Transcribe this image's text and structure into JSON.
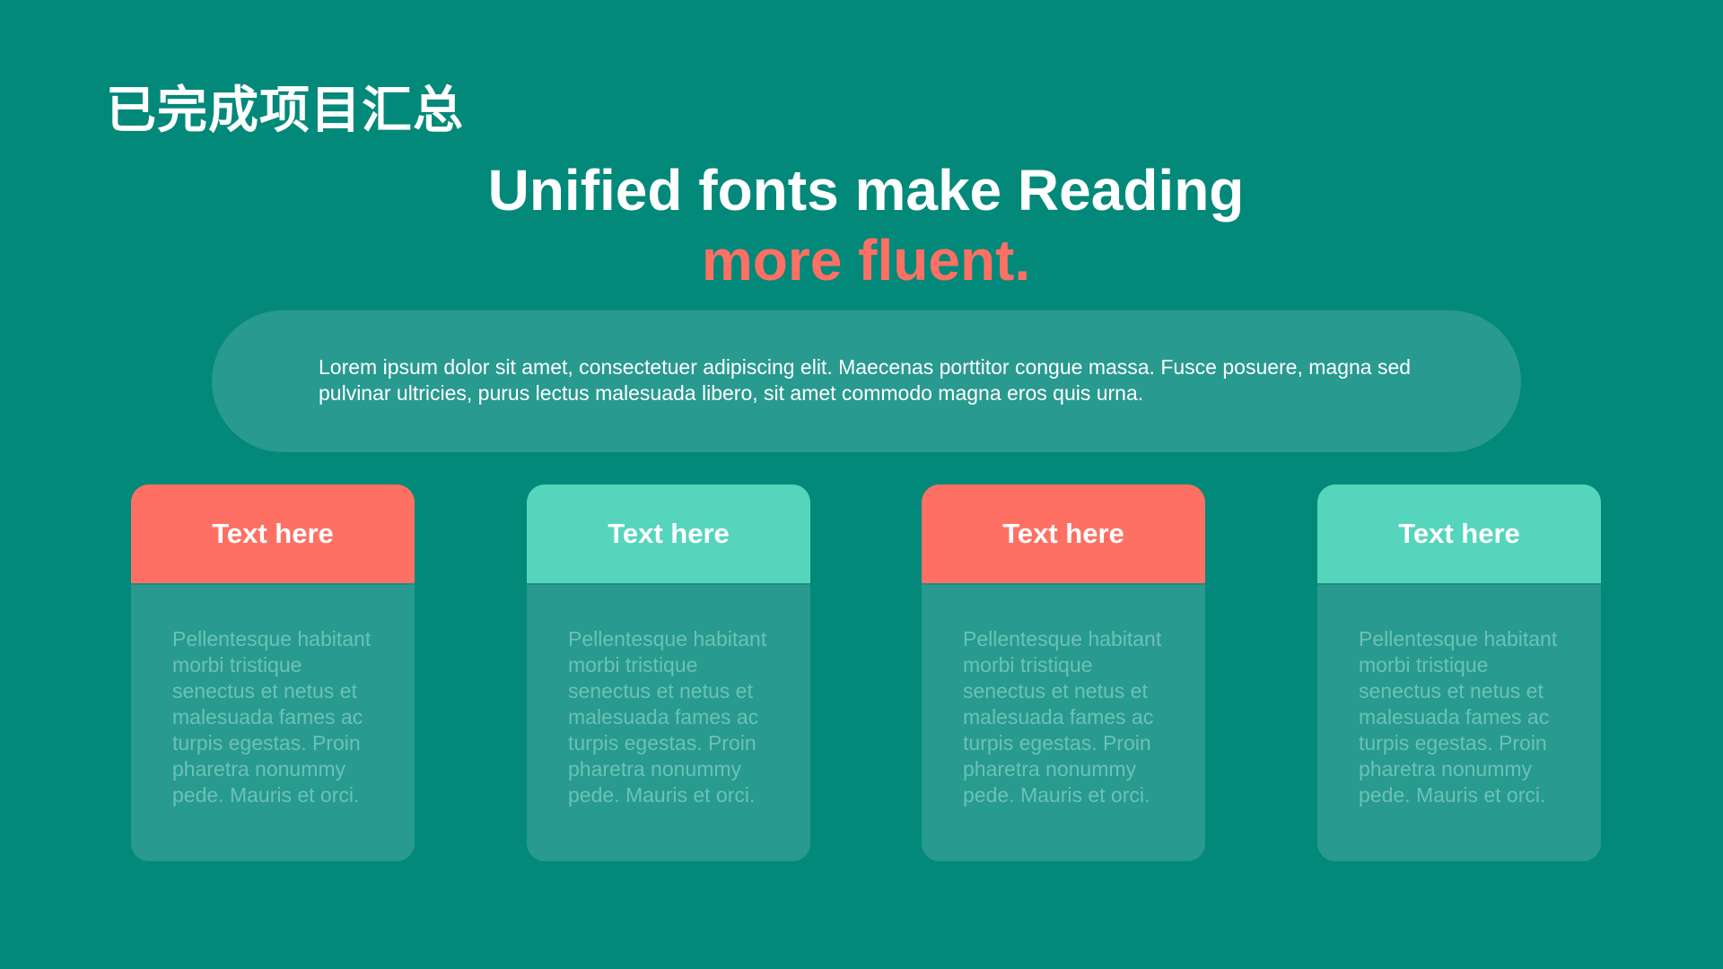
{
  "slide": {
    "title": "已完成项目汇总",
    "headline_line1": "Unified fonts make Reading",
    "headline_line2": "more fluent.",
    "intro": "Lorem ipsum dolor sit amet, consectetuer adipiscing elit. Maecenas porttitor congue massa. Fusce posuere, magna sed pulvinar ultricies, purus lectus malesuada libero, sit amet commodo magna eros quis urna."
  },
  "colors": {
    "background": "#02897a",
    "accent_coral": "#fe7064",
    "accent_mint": "#56d5bd",
    "panel": "#289a8f"
  },
  "cards": [
    {
      "title": "Text here",
      "header_color": "coral",
      "body": "Pellentesque habitant morbi tristique senectus et netus et malesuada fames ac turpis egestas. Proin pharetra nonummy pede. Mauris et orci."
    },
    {
      "title": "Text here",
      "header_color": "mint",
      "body": "Pellentesque habitant morbi tristique senectus et netus et malesuada fames ac turpis egestas. Proin pharetra nonummy pede. Mauris et orci."
    },
    {
      "title": "Text here",
      "header_color": "coral",
      "body": "Pellentesque habitant morbi tristique senectus et netus et malesuada fames ac turpis egestas. Proin pharetra nonummy pede. Mauris et orci."
    },
    {
      "title": "Text here",
      "header_color": "mint",
      "body": "Pellentesque habitant morbi tristique senectus et netus et malesuada fames ac turpis egestas. Proin pharetra nonummy pede. Mauris et orci."
    }
  ]
}
